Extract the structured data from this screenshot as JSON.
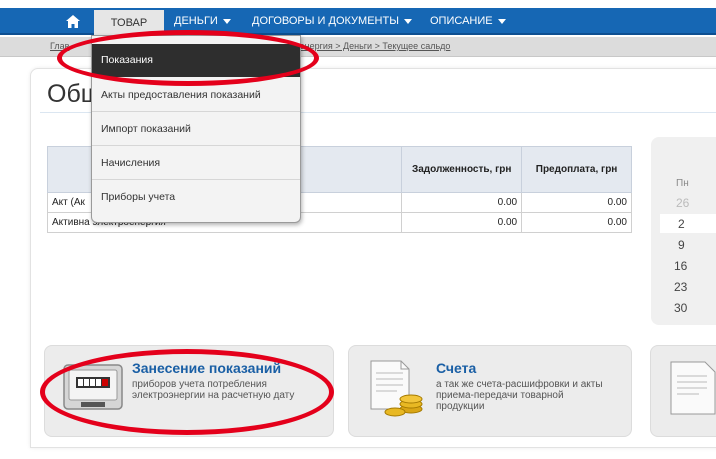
{
  "nav": {
    "items": [
      {
        "label": "ТОВАР"
      },
      {
        "label": "ДЕНЬГИ"
      },
      {
        "label": "ДОГОВОРЫ И ДОКУМЕНТЫ"
      },
      {
        "label": "ОПИСАНИЕ"
      }
    ]
  },
  "breadcrumb": {
    "left": "Глав",
    "right": "энергия > Деньги > Текущее сальдо"
  },
  "page": {
    "title": "Общ"
  },
  "table": {
    "headers": [
      "",
      "Задолженность, грн",
      "Предоплата, грн"
    ],
    "rows": [
      {
        "name": "Акт (Ак",
        "debt": "0.00",
        "prepay": "0.00"
      },
      {
        "name": "Активна электроенергия",
        "debt": "0.00",
        "prepay": "0.00"
      }
    ]
  },
  "calendar": {
    "weekday": "Пн",
    "days": [
      "26",
      "2",
      "9",
      "16",
      "23",
      "30"
    ]
  },
  "dropdown": {
    "items": [
      {
        "label": "Показания"
      },
      {
        "label": "Акты предоставления показаний"
      },
      {
        "label": "Импорт показаний"
      },
      {
        "label": "Начисления"
      },
      {
        "label": "Приборы учета"
      }
    ]
  },
  "cards": [
    {
      "title": "Занесение показаний",
      "desc": "приборов учета потребления электроэнергии на расчетную дату"
    },
    {
      "title": "Счета",
      "desc": "а так же счета-расшифровки и акты приема-передачи товарной продукции"
    }
  ],
  "colors": {
    "nav_bg": "#1667b4",
    "accent": "#1a5fa5",
    "annotation": "#e4001b",
    "menu_active": "#2e2e2e"
  }
}
